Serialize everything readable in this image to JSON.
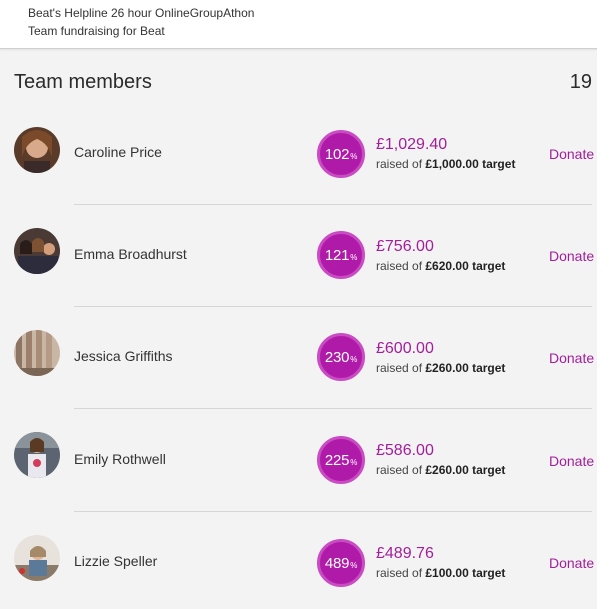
{
  "header": {
    "title": "Beat's Helpline 26 hour OnlineGroupAthon",
    "subtitle": "Team fundraising for Beat"
  },
  "members_section": {
    "title": "Team members",
    "count": "19"
  },
  "members": [
    {
      "name": "Caroline Price",
      "percent": "102",
      "percent_unit": "%",
      "raised": "£1,029.40",
      "raised_of": "raised of",
      "target": "£1,000.00 target",
      "donate_label": "Donate"
    },
    {
      "name": "Emma Broadhurst",
      "percent": "121",
      "percent_unit": "%",
      "raised": "£756.00",
      "raised_of": "raised of",
      "target": "£620.00 target",
      "donate_label": "Donate"
    },
    {
      "name": "Jessica Griffiths",
      "percent": "230",
      "percent_unit": "%",
      "raised": "£600.00",
      "raised_of": "raised of",
      "target": "£260.00 target",
      "donate_label": "Donate"
    },
    {
      "name": "Emily Rothwell",
      "percent": "225",
      "percent_unit": "%",
      "raised": "£586.00",
      "raised_of": "raised of",
      "target": "£260.00 target",
      "donate_label": "Donate"
    },
    {
      "name": "Lizzie Speller",
      "percent": "489",
      "percent_unit": "%",
      "raised": "£489.76",
      "raised_of": "raised of",
      "target": "£100.00 target",
      "donate_label": "Donate"
    }
  ],
  "colors": {
    "accent": "#a31e9b",
    "badge": "#b01aa9",
    "background": "#f3f3f3"
  }
}
